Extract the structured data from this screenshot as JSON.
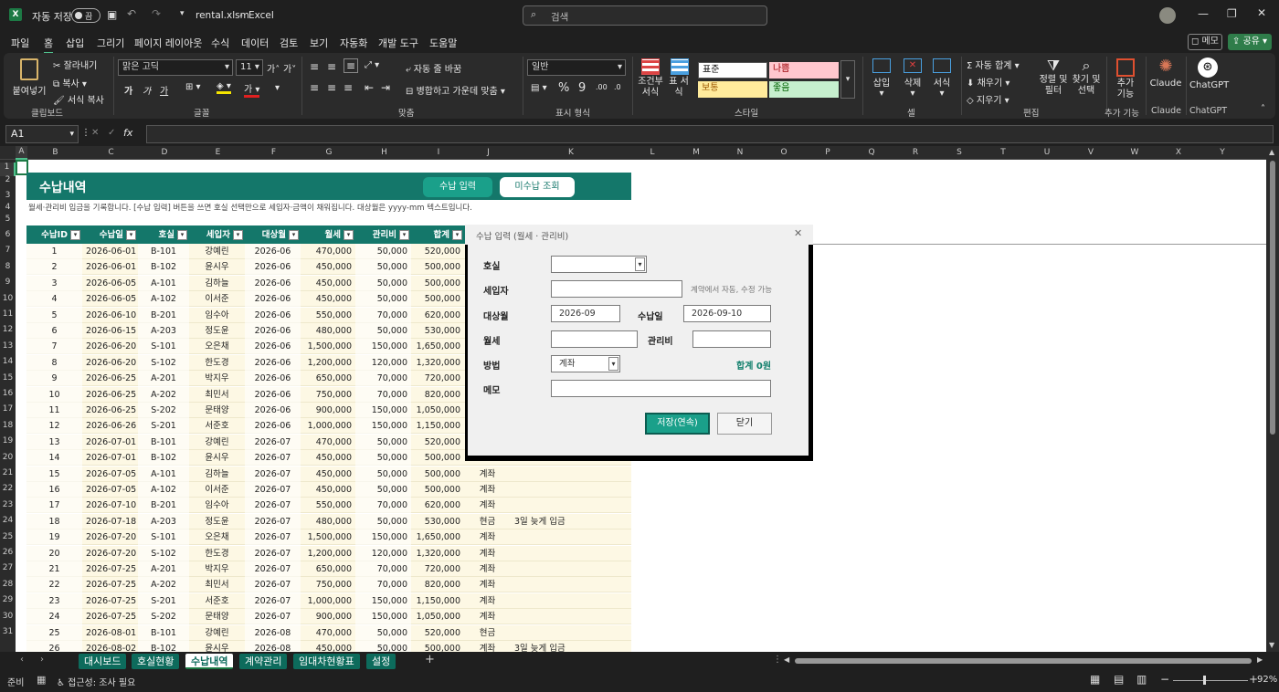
{
  "titlebar": {
    "autosave_label": "자동 저장",
    "autosave_state": "끔",
    "filename": "rental.xlsm",
    "app": "Excel",
    "search_placeholder": "검색"
  },
  "menu": [
    "파일",
    "홈",
    "삽입",
    "그리기",
    "페이지 레이아웃",
    "수식",
    "데이터",
    "검토",
    "보기",
    "자동화",
    "개발 도구",
    "도움말"
  ],
  "menu_right": {
    "memo": "메모",
    "share": "공유"
  },
  "ribbon": {
    "clipboard": {
      "paste": "붙여넣기",
      "cut": "잘라내기",
      "copy": "복사",
      "format_copy": "서식 복사",
      "group": "클립보드"
    },
    "font": {
      "name": "맑은 고딕",
      "size": "11",
      "group": "글꼴",
      "bold": "가",
      "italic": "가",
      "underline": "가",
      "grow": "가",
      "shrink": "가"
    },
    "align": {
      "wrap": "자동 줄 바꿈",
      "merge": "병합하고 가운데 맞춤",
      "group": "맞춤"
    },
    "number": {
      "format": "일반",
      "group": "표시 형식"
    },
    "styles": {
      "cond": "조건부 서식",
      "table": "표 서식",
      "normal": "표준",
      "bad": "나쁨",
      "neutral": "보통",
      "good": "좋음",
      "group": "스타일"
    },
    "cells": {
      "insert": "삽입",
      "delete": "삭제",
      "format": "서식",
      "group": "셀"
    },
    "edit": {
      "autosum": "자동 합계",
      "fill": "채우기",
      "clear": "지우기",
      "sort": "정렬 및 필터",
      "find": "찾기 및 선택",
      "group": "편집"
    },
    "addins": {
      "label": "추가 기능",
      "group": "추가 기능"
    },
    "claude": {
      "label": "Claude",
      "group": "Claude"
    },
    "chatgpt": {
      "label": "ChatGPT",
      "group": "ChatGPT"
    }
  },
  "formula_bar": {
    "namebox": "A1",
    "fx": "fx",
    "content": ""
  },
  "columns": [
    "A",
    "B",
    "C",
    "D",
    "E",
    "F",
    "G",
    "H",
    "I",
    "J",
    "K",
    "L",
    "M",
    "N",
    "O",
    "P",
    "Q",
    "R",
    "S",
    "T",
    "U",
    "V",
    "W",
    "X",
    "Y"
  ],
  "rows": [
    "1",
    "2",
    "3",
    "4",
    "5",
    "6",
    "7",
    "8",
    "9",
    "10",
    "11",
    "12",
    "13",
    "14",
    "15",
    "16",
    "17",
    "18",
    "19",
    "20",
    "21",
    "22",
    "23",
    "24",
    "25",
    "26",
    "27",
    "28",
    "29",
    "30",
    "31"
  ],
  "sheet": {
    "title": "수납내역",
    "btn_input": "수납 입력",
    "btn_unpaid": "미수납 조회",
    "desc": "월세·관리비 입금을 기록합니다. [수납 입력] 버튼을 쓰면 호실 선택만으로 세입자·금액이 채워집니다. 대상월은 yyyy-mm 텍스트입니다.",
    "headers": [
      "수납ID",
      "수납일",
      "호실",
      "세입자",
      "대상월",
      "월세",
      "관리비",
      "합계"
    ],
    "rows": [
      [
        "1",
        "2026-06-01",
        "B-101",
        "강예린",
        "2026-06",
        "470,000",
        "50,000",
        "520,000",
        "",
        ""
      ],
      [
        "2",
        "2026-06-01",
        "B-102",
        "윤시우",
        "2026-06",
        "450,000",
        "50,000",
        "500,000",
        "",
        ""
      ],
      [
        "3",
        "2026-06-05",
        "A-101",
        "김하늘",
        "2026-06",
        "450,000",
        "50,000",
        "500,000",
        "",
        ""
      ],
      [
        "4",
        "2026-06-05",
        "A-102",
        "이서준",
        "2026-06",
        "450,000",
        "50,000",
        "500,000",
        "",
        ""
      ],
      [
        "5",
        "2026-06-10",
        "B-201",
        "임수아",
        "2026-06",
        "550,000",
        "70,000",
        "620,000",
        "",
        ""
      ],
      [
        "6",
        "2026-06-15",
        "A-203",
        "정도윤",
        "2026-06",
        "480,000",
        "50,000",
        "530,000",
        "",
        ""
      ],
      [
        "7",
        "2026-06-20",
        "S-101",
        "오은채",
        "2026-06",
        "1,500,000",
        "150,000",
        "1,650,000",
        "",
        ""
      ],
      [
        "8",
        "2026-06-20",
        "S-102",
        "한도경",
        "2026-06",
        "1,200,000",
        "120,000",
        "1,320,000",
        "",
        ""
      ],
      [
        "9",
        "2026-06-25",
        "A-201",
        "박지우",
        "2026-06",
        "650,000",
        "70,000",
        "720,000",
        "",
        ""
      ],
      [
        "10",
        "2026-06-25",
        "A-202",
        "최민서",
        "2026-06",
        "750,000",
        "70,000",
        "820,000",
        "",
        ""
      ],
      [
        "11",
        "2026-06-25",
        "S-202",
        "문태양",
        "2026-06",
        "900,000",
        "150,000",
        "1,050,000",
        "",
        ""
      ],
      [
        "12",
        "2026-06-26",
        "S-201",
        "서준호",
        "2026-06",
        "1,000,000",
        "150,000",
        "1,150,000",
        "",
        ""
      ],
      [
        "13",
        "2026-07-01",
        "B-101",
        "강예린",
        "2026-07",
        "470,000",
        "50,000",
        "520,000",
        "",
        ""
      ],
      [
        "14",
        "2026-07-01",
        "B-102",
        "윤시우",
        "2026-07",
        "450,000",
        "50,000",
        "500,000",
        "",
        ""
      ],
      [
        "15",
        "2026-07-05",
        "A-101",
        "김하늘",
        "2026-07",
        "450,000",
        "50,000",
        "500,000",
        "계좌",
        ""
      ],
      [
        "16",
        "2026-07-05",
        "A-102",
        "이서준",
        "2026-07",
        "450,000",
        "50,000",
        "500,000",
        "계좌",
        ""
      ],
      [
        "17",
        "2026-07-10",
        "B-201",
        "임수아",
        "2026-07",
        "550,000",
        "70,000",
        "620,000",
        "계좌",
        ""
      ],
      [
        "18",
        "2026-07-18",
        "A-203",
        "정도윤",
        "2026-07",
        "480,000",
        "50,000",
        "530,000",
        "현금",
        "3일 늦게 입금"
      ],
      [
        "19",
        "2026-07-20",
        "S-101",
        "오은채",
        "2026-07",
        "1,500,000",
        "150,000",
        "1,650,000",
        "계좌",
        ""
      ],
      [
        "20",
        "2026-07-20",
        "S-102",
        "한도경",
        "2026-07",
        "1,200,000",
        "120,000",
        "1,320,000",
        "계좌",
        ""
      ],
      [
        "21",
        "2026-07-25",
        "A-201",
        "박지우",
        "2026-07",
        "650,000",
        "70,000",
        "720,000",
        "계좌",
        ""
      ],
      [
        "22",
        "2026-07-25",
        "A-202",
        "최민서",
        "2026-07",
        "750,000",
        "70,000",
        "820,000",
        "계좌",
        ""
      ],
      [
        "23",
        "2026-07-25",
        "S-201",
        "서준호",
        "2026-07",
        "1,000,000",
        "150,000",
        "1,150,000",
        "계좌",
        ""
      ],
      [
        "24",
        "2026-07-25",
        "S-202",
        "문태양",
        "2026-07",
        "900,000",
        "150,000",
        "1,050,000",
        "계좌",
        ""
      ],
      [
        "25",
        "2026-08-01",
        "B-101",
        "강예린",
        "2026-08",
        "470,000",
        "50,000",
        "520,000",
        "현금",
        ""
      ],
      [
        "26",
        "2026-08-02",
        "B-102",
        "윤시우",
        "2026-08",
        "450,000",
        "50,000",
        "500,000",
        "계좌",
        "3일 늦게 입금"
      ]
    ]
  },
  "dialog": {
    "title": "수납 입력 (월세 · 관리비)",
    "room_label": "호실",
    "room_value": "",
    "tenant_label": "세입자",
    "tenant_value": "",
    "tenant_hint": "계약에서 자동, 수정 가능",
    "month_label": "대상월",
    "month_value": "2026-09",
    "date_label": "수납일",
    "date_value": "2026-09-10",
    "rent_label": "월세",
    "rent_value": "",
    "fee_label": "관리비",
    "fee_value": "",
    "method_label": "방법",
    "method_value": "계좌",
    "total": "합계 0원",
    "memo_label": "메모",
    "memo_value": "",
    "save": "저장(연속)",
    "close": "닫기"
  },
  "tabs": [
    "대시보드",
    "호실현황",
    "수납내역",
    "계약관리",
    "임대차현황표",
    "설정"
  ],
  "active_tab": "수납내역",
  "status": {
    "ready": "준비",
    "access": "접근성: 조사 필요",
    "zoom": "92%"
  }
}
